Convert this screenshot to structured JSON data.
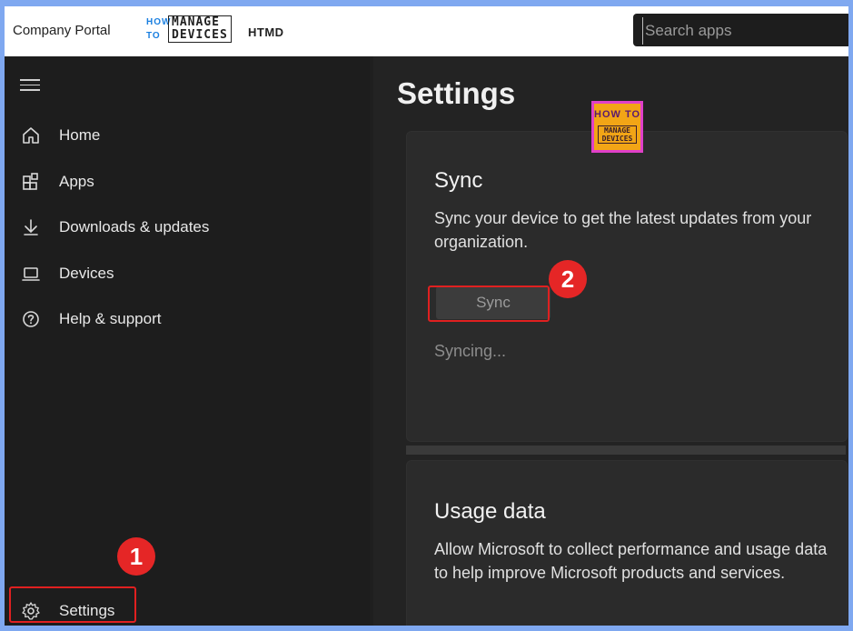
{
  "app": {
    "title": "Company Portal",
    "brand": "HTMD"
  },
  "logo": {
    "line1": "HOW",
    "line2": "TO",
    "box_line1": "MANAGE",
    "box_line2": "DEVICES"
  },
  "search": {
    "placeholder": "Search apps"
  },
  "sidebar": {
    "items": [
      {
        "label": "Home",
        "icon": "home-icon"
      },
      {
        "label": "Apps",
        "icon": "apps-icon"
      },
      {
        "label": "Downloads & updates",
        "icon": "download-icon"
      },
      {
        "label": "Devices",
        "icon": "laptop-icon"
      },
      {
        "label": "Help & support",
        "icon": "help-icon"
      }
    ],
    "settings": {
      "label": "Settings",
      "icon": "gear-icon"
    }
  },
  "main": {
    "title": "Settings",
    "sync_card": {
      "heading": "Sync",
      "description": "Sync your device to get the latest updates from your organization.",
      "button_label": "Sync",
      "status": "Syncing..."
    },
    "usage_card": {
      "heading": "Usage data",
      "description": "Allow Microsoft to collect performance and usage data to help improve Microsoft products and services."
    }
  },
  "annotations": {
    "badge1": "1",
    "badge2": "2"
  },
  "watermark": {
    "line1": "HOW TO",
    "line2": "MANAGE",
    "line3": "DEVICES"
  },
  "colors": {
    "highlight": "#e02020",
    "badge": "#e52626",
    "frame": "#7fa8f0"
  }
}
